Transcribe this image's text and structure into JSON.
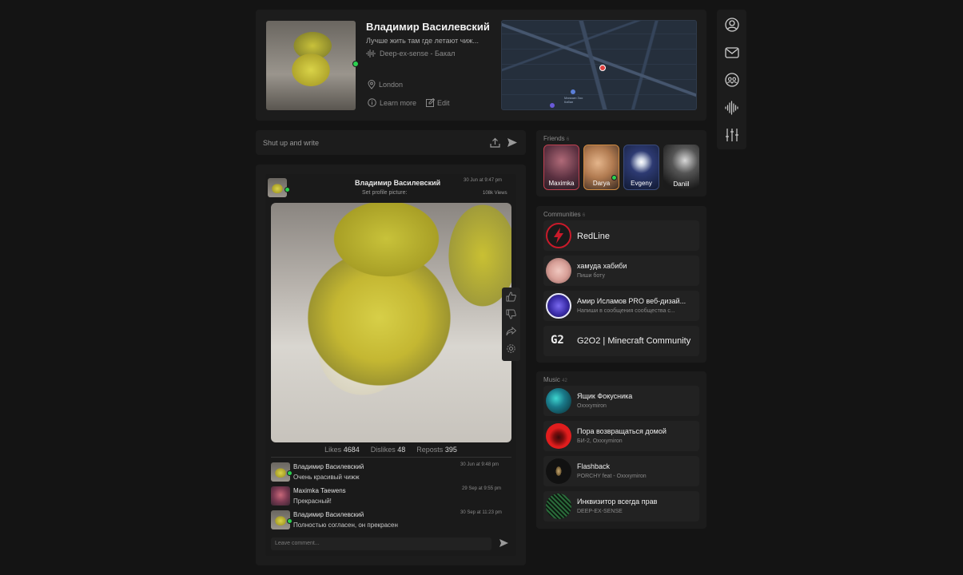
{
  "profile": {
    "name": "Владимир Василевский",
    "status": "Лучше жить там где летают чиж...",
    "now_playing": "Deep-ex-sense - Бакал",
    "location": "London",
    "learn_more": "Learn more",
    "edit": "Edit"
  },
  "composer": {
    "placeholder": "Shut up and write"
  },
  "post": {
    "author": "Владимир Василевский",
    "time": "30 Jun at 9:47 pm",
    "subtitle": "Set profile picture:",
    "views": "108k Views",
    "likes_label": "Likes",
    "likes": "4684",
    "dislikes_label": "Dislikes",
    "dislikes": "48",
    "reposts_label": "Reposts",
    "reposts": "395"
  },
  "comments": [
    {
      "author": "Владимир Василевский",
      "text": "Очень красивый чижж",
      "time": "30 Jun at 9:48 pm"
    },
    {
      "author": "Maximka Taewens",
      "text": "Прекрасный!",
      "time": "29 Sep at 9:55 pm"
    },
    {
      "author": "Владимир Василевский",
      "text": "Полностью согласен, он прекрасен",
      "time": "30 Sep at 11:23 pm"
    }
  ],
  "comment_input": {
    "placeholder": "Leave comment..."
  },
  "friends": {
    "title": "Friends",
    "count": "6",
    "items": [
      {
        "name": "Maximka"
      },
      {
        "name": "Darya"
      },
      {
        "name": "Evgeny"
      },
      {
        "name": "Daniil"
      }
    ]
  },
  "communities": {
    "title": "Communities",
    "count": "6",
    "items": [
      {
        "name": "RedLine",
        "sub": ""
      },
      {
        "name": "хамуда хабиби",
        "sub": "Пиши боту"
      },
      {
        "name": "Амир Исламов PRO веб-дизай...",
        "sub": "Напиши в сообщения сообщества с..."
      },
      {
        "name": "G2O2 | Minecraft Community",
        "sub": "",
        "logo": "G2"
      }
    ]
  },
  "music": {
    "title": "Music",
    "count": "42",
    "items": [
      {
        "name": "Ящик Фокусника",
        "artist": "Oxxxymiron"
      },
      {
        "name": "Пора возвращаться домой",
        "artist": "БИ-2, Oxxxymiron"
      },
      {
        "name": "Flashback",
        "artist": "PORCHY feat - Oxxxymiron"
      },
      {
        "name": "Инквизитор всегда прав",
        "artist": "DEEP-EX-SENSE"
      }
    ]
  },
  "sidebar": {
    "icons": [
      "user-icon",
      "mail-icon",
      "people-icon",
      "audio-wave-icon",
      "sliders-icon"
    ]
  },
  "map": {
    "label": "Магазин Зоо Кабан"
  },
  "colors": {
    "online": "#2bd14f",
    "accent_red": "#e01d1d"
  }
}
